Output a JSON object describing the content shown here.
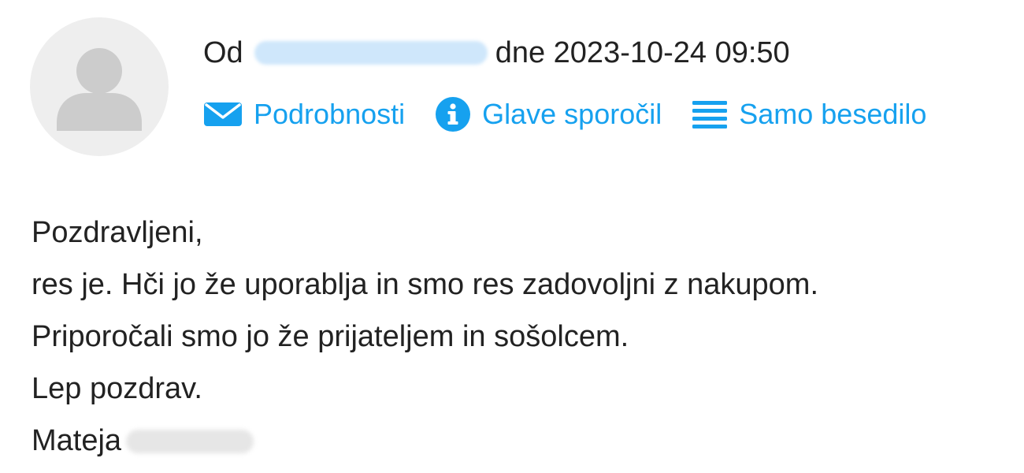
{
  "header": {
    "from_label": "Od",
    "date_label": "dne 2023-10-24 09:50"
  },
  "actions": {
    "details": {
      "label": "Podrobnosti",
      "icon": "envelope-icon"
    },
    "headers": {
      "label": "Glave sporočil",
      "icon": "info-icon"
    },
    "plain_text": {
      "label": "Samo besedilo",
      "icon": "lines-icon"
    }
  },
  "message": {
    "line1": "Pozdravljeni,",
    "line2": "res je. Hči jo že uporablja in smo res zadovoljni z nakupom.",
    "line3": "Priporočali smo jo že prijateljem in sošolcem.",
    "line4": "Lep pozdrav.",
    "signature_first_name": "Mateja"
  },
  "colors": {
    "accent": "#16a1ef",
    "text": "#222222",
    "avatar_bg": "#eeeeee",
    "avatar_fg": "#cccccc"
  }
}
